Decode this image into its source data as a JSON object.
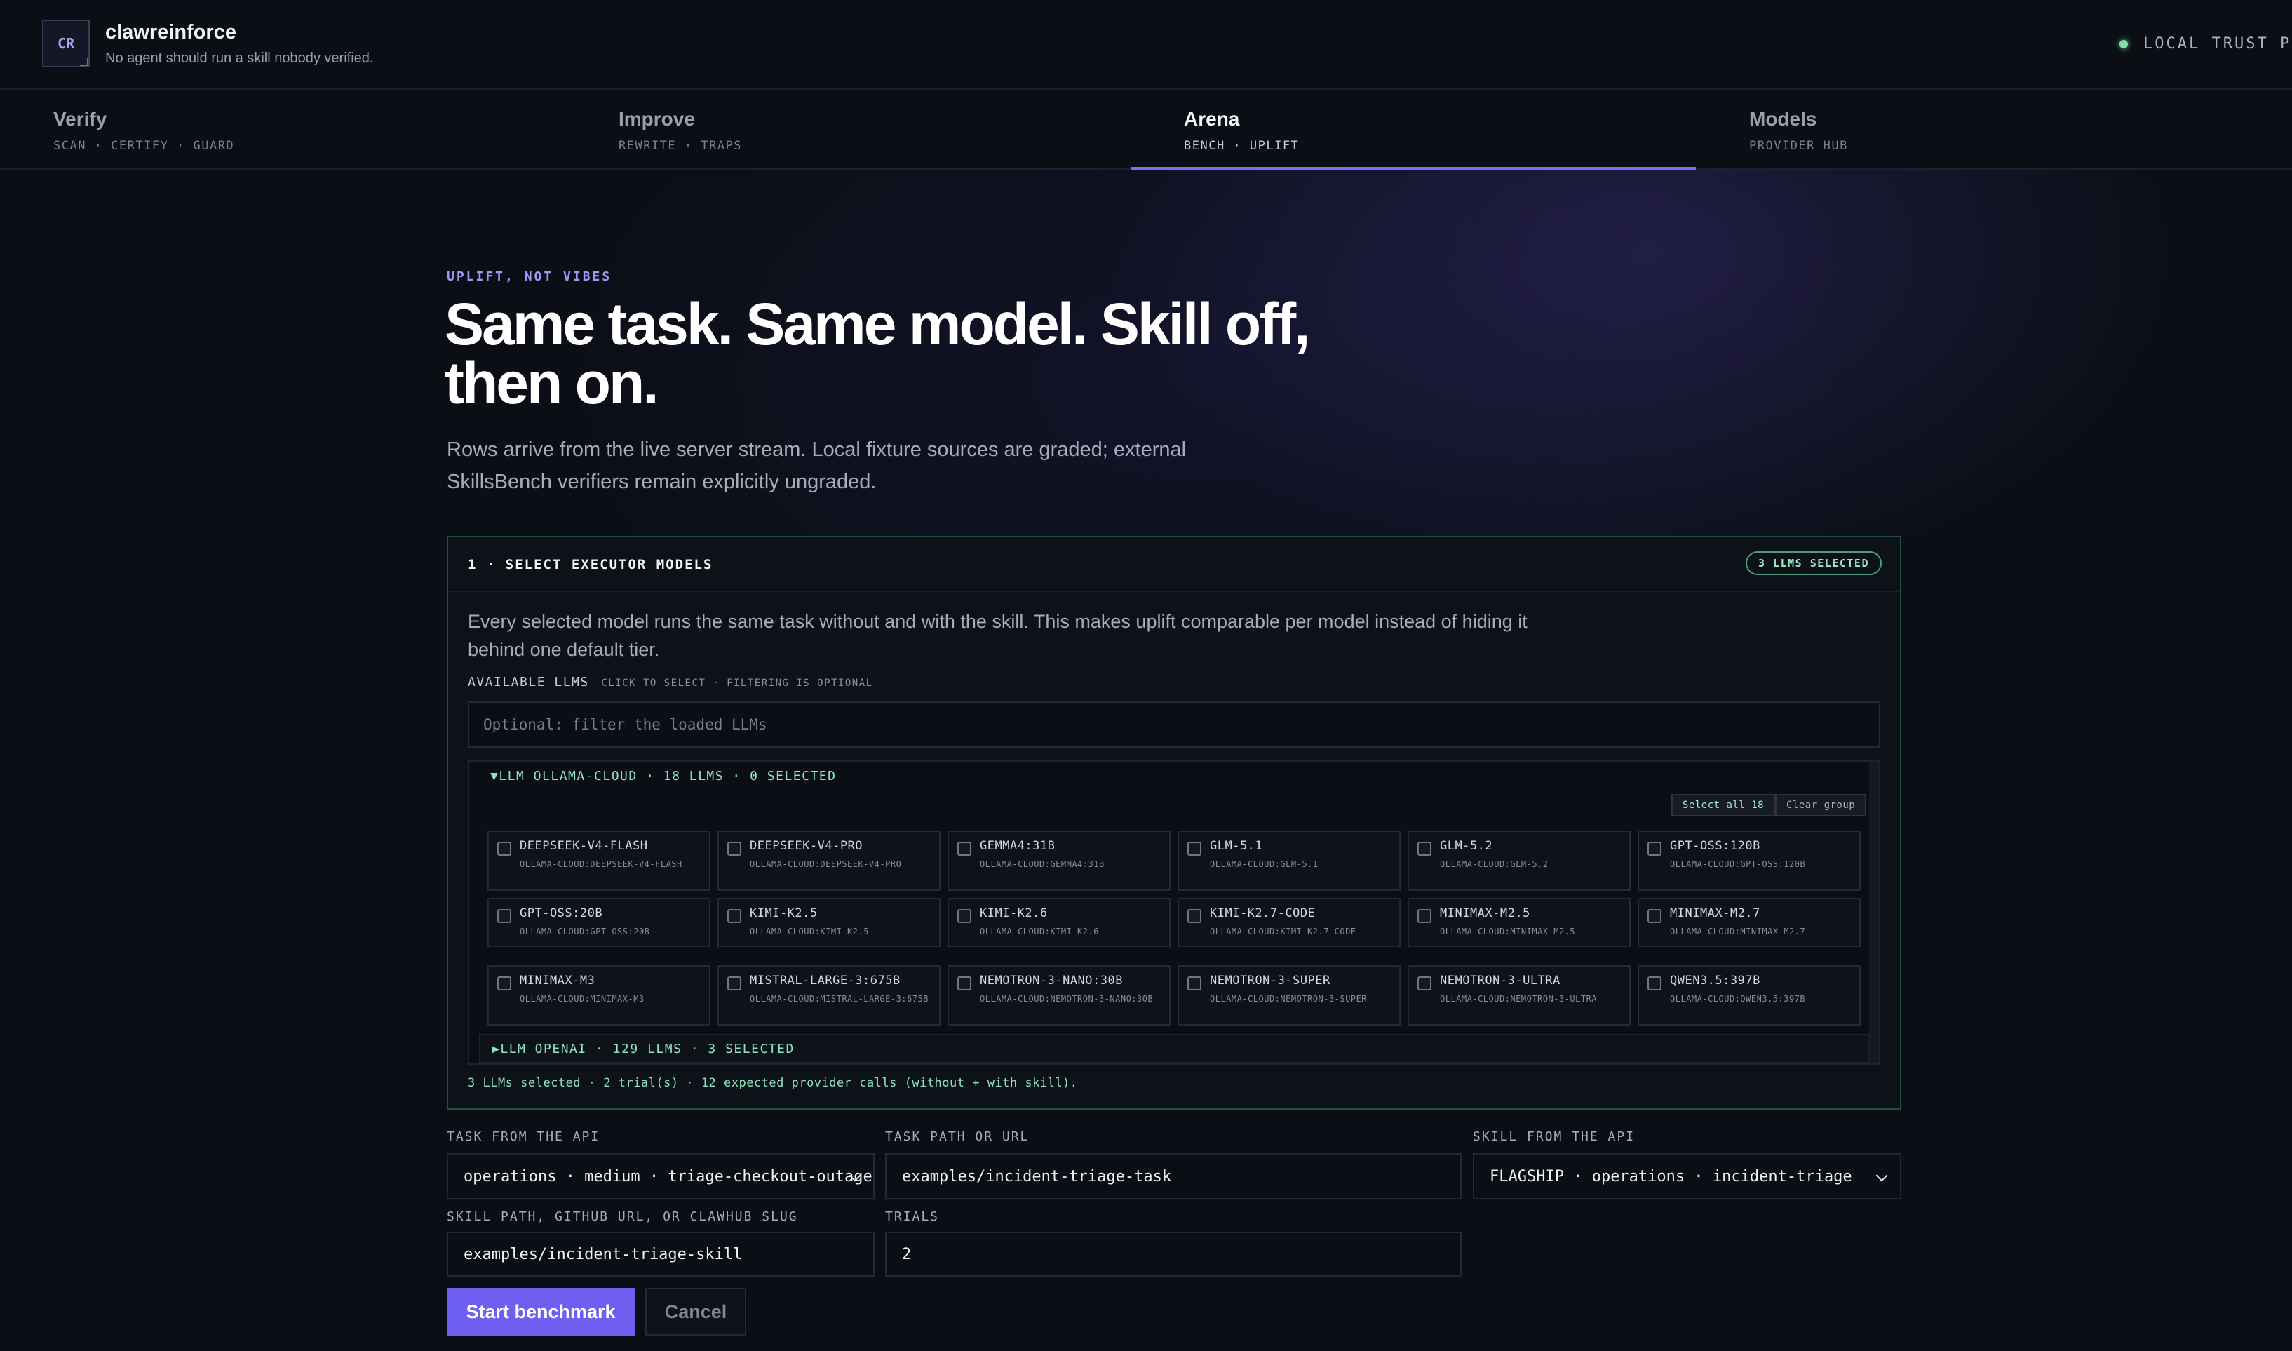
{
  "app": {
    "logo": "CR",
    "title": "clawreinforce",
    "tagline": "No agent should run a skill nobody verified.",
    "status": "LOCAL TRUST PLANE"
  },
  "tabs": [
    {
      "title": "Verify",
      "sub": "SCAN · CERTIFY · GUARD"
    },
    {
      "title": "Improve",
      "sub": "REWRITE · TRAPS"
    },
    {
      "title": "Arena",
      "sub": "BENCH · UPLIFT"
    },
    {
      "title": "Models",
      "sub": "PROVIDER HUB"
    }
  ],
  "hero": {
    "eyebrow": "UPLIFT, NOT VIBES",
    "title": "Same task. Same model. Skill off, then on.",
    "description": "Rows arrive from the live server stream. Local fixture sources are graded; external SkillsBench verifiers remain explicitly ungraded."
  },
  "panel": {
    "step": "1 · SELECT EXECUTOR MODELS",
    "badge": "3 LLMS SELECTED",
    "description": "Every selected model runs the same task without and with the skill. This makes uplift comparable per model instead of hiding it behind one default tier.",
    "available_label": "AVAILABLE LLMS",
    "available_hint": "CLICK TO SELECT · FILTERING IS OPTIONAL",
    "filter_placeholder": "Optional: filter the loaded LLMs",
    "group1": {
      "header": "▼LLM OLLAMA-CLOUD · 18 LLMS · 0 SELECTED",
      "select_all": "Select all 18",
      "clear": "Clear group",
      "models": [
        {
          "name": "DEEPSEEK-V4-FLASH",
          "id": "OLLAMA-CLOUD:DEEPSEEK-V4-FLASH"
        },
        {
          "name": "DEEPSEEK-V4-PRO",
          "id": "OLLAMA-CLOUD:DEEPSEEK-V4-PRO"
        },
        {
          "name": "GEMMA4:31B",
          "id": "OLLAMA-CLOUD:GEMMA4:31B"
        },
        {
          "name": "GLM-5.1",
          "id": "OLLAMA-CLOUD:GLM-5.1"
        },
        {
          "name": "GLM-5.2",
          "id": "OLLAMA-CLOUD:GLM-5.2"
        },
        {
          "name": "GPT-OSS:120B",
          "id": "OLLAMA-CLOUD:GPT-OSS:120B"
        },
        {
          "name": "GPT-OSS:20B",
          "id": "OLLAMA-CLOUD:GPT-OSS:20B"
        },
        {
          "name": "KIMI-K2.5",
          "id": "OLLAMA-CLOUD:KIMI-K2.5"
        },
        {
          "name": "KIMI-K2.6",
          "id": "OLLAMA-CLOUD:KIMI-K2.6"
        },
        {
          "name": "KIMI-K2.7-CODE",
          "id": "OLLAMA-CLOUD:KIMI-K2.7-CODE"
        },
        {
          "name": "MINIMAX-M2.5",
          "id": "OLLAMA-CLOUD:MINIMAX-M2.5"
        },
        {
          "name": "MINIMAX-M2.7",
          "id": "OLLAMA-CLOUD:MINIMAX-M2.7"
        },
        {
          "name": "MINIMAX-M3",
          "id": "OLLAMA-CLOUD:MINIMAX-M3"
        },
        {
          "name": "MISTRAL-LARGE-3:675B",
          "id": "OLLAMA-CLOUD:MISTRAL-LARGE-3:675B"
        },
        {
          "name": "NEMOTRON-3-NANO:30B",
          "id": "OLLAMA-CLOUD:NEMOTRON-3-NANO:30B"
        },
        {
          "name": "NEMOTRON-3-SUPER",
          "id": "OLLAMA-CLOUD:NEMOTRON-3-SUPER"
        },
        {
          "name": "NEMOTRON-3-ULTRA",
          "id": "OLLAMA-CLOUD:NEMOTRON-3-ULTRA"
        },
        {
          "name": "QWEN3.5:397B",
          "id": "OLLAMA-CLOUD:QWEN3.5:397B"
        }
      ]
    },
    "group2": {
      "header": "▶LLM OPENAI · 129 LLMS · 3 SELECTED"
    },
    "summary": "3 LLMs selected · 2 trial(s) · 12 expected provider calls (without + with skill)."
  },
  "form": {
    "task_api_label": "TASK FROM THE API",
    "task_api_value": "operations · medium · triage-checkout-outage",
    "task_path_label": "TASK PATH OR URL",
    "task_path_value": "examples/incident-triage-task",
    "skill_api_label": "SKILL FROM THE API",
    "skill_api_value": "FLAGSHIP · operations · incident-triage",
    "skill_path_label": "SKILL PATH, GITHUB URL, OR CLAWHUB SLUG",
    "skill_path_value": "examples/incident-triage-skill",
    "trials_label": "TRIALS",
    "trials_value": "2",
    "start": "Start benchmark",
    "cancel": "Cancel"
  },
  "colors": {
    "accent": "#7b6ef0",
    "primary_button": "#6e5ff0",
    "success_text": "#8ee3c0",
    "background": "#0b0e15"
  }
}
